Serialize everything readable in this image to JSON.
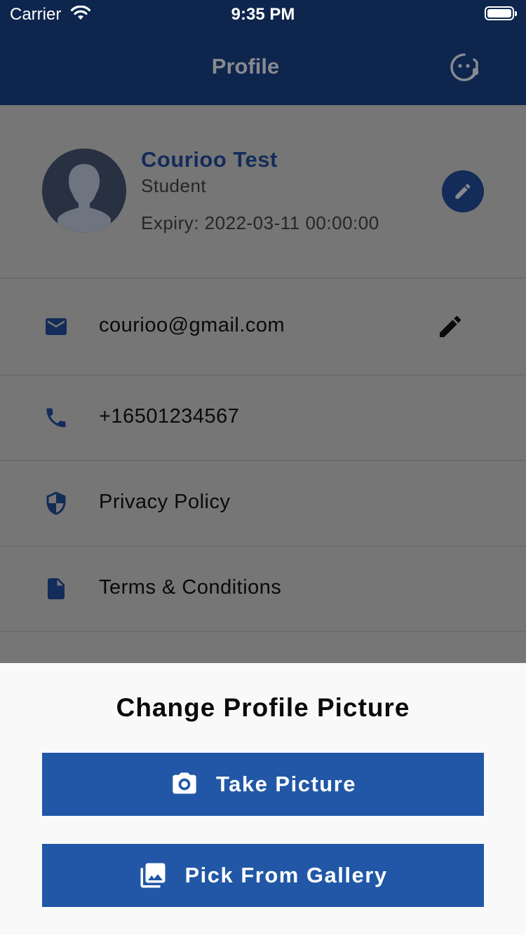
{
  "status_bar": {
    "carrier": "Carrier",
    "time": "9:35 PM"
  },
  "app_bar": {
    "title": "Profile",
    "right_icon": "support-agent-icon"
  },
  "profile": {
    "name": "Courioo Test",
    "role": "Student",
    "expiry": "Expiry: 2022-03-11 00:00:00",
    "edit_icon": "pencil-icon"
  },
  "rows": {
    "email": {
      "icon": "email-icon",
      "label": "courioo@gmail.com",
      "edit_icon": "pencil-icon"
    },
    "phone": {
      "icon": "phone-icon",
      "label": "+16501234567"
    },
    "privacy": {
      "icon": "shield-icon",
      "label": "Privacy Policy"
    },
    "terms": {
      "icon": "document-icon",
      "label": "Terms & Conditions"
    }
  },
  "sheet": {
    "title": "Change Profile Picture",
    "take_picture": {
      "icon": "camera-icon",
      "label": "Take Picture"
    },
    "pick_gallery": {
      "icon": "gallery-icon",
      "label": "Pick From Gallery"
    }
  },
  "colors": {
    "app_bar": "#0e254d",
    "primary_button": "#2157a6",
    "overlay_background": "#767676",
    "sheet_background": "#f9f9f9"
  }
}
